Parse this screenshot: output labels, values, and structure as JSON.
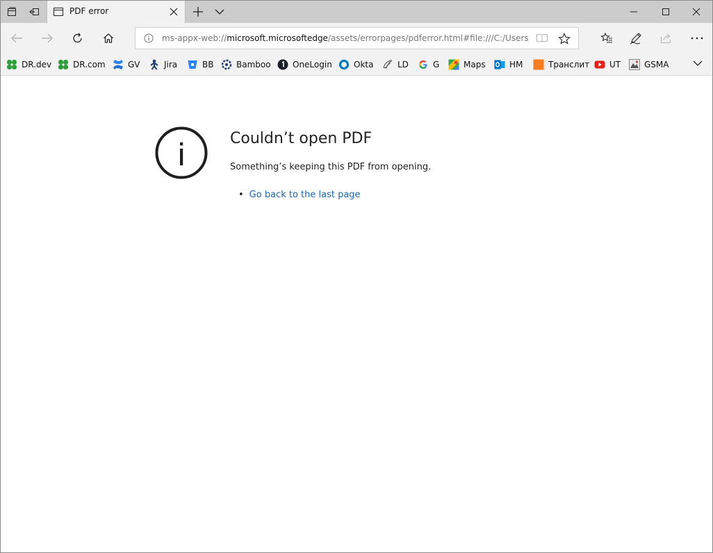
{
  "tab": {
    "title": "PDF error"
  },
  "address_bar": {
    "prefix": "ms-appx-web://",
    "host": "microsoft.microsoftedge",
    "path": "/assets/errorpages/pdferror.html#file:///C:/Users/Ar"
  },
  "favorites": [
    {
      "label": "DR.dev",
      "icon": "clover-icon",
      "color": "#2e9e3a"
    },
    {
      "label": "DR.com",
      "icon": "clover-icon",
      "color": "#2e9e3a"
    },
    {
      "label": "GV",
      "icon": "confluence-icon",
      "color": "#1f6fd6"
    },
    {
      "label": "Jira",
      "icon": "jira-icon",
      "color": "#1e3c72"
    },
    {
      "label": "BB",
      "icon": "bitbucket-icon",
      "color": "#2684ff"
    },
    {
      "label": "Bamboo",
      "icon": "bamboo-icon",
      "color": "#1e3c72"
    },
    {
      "label": "OneLogin",
      "icon": "onelogin-icon",
      "color": "#1c1f2a"
    },
    {
      "label": "Okta",
      "icon": "okta-icon",
      "color": "#007dc1"
    },
    {
      "label": "LD",
      "icon": "ld-icon",
      "color": "#666666"
    },
    {
      "label": "G",
      "icon": "google-icon",
      "color": "#4285f4"
    },
    {
      "label": "Maps",
      "icon": "maps-icon",
      "color": "#34a853"
    },
    {
      "label": "HM",
      "icon": "outlook-icon",
      "color": "#0072c6"
    },
    {
      "label": "Транслит",
      "icon": "translit-icon",
      "color": "#f57c1f"
    },
    {
      "label": "UT",
      "icon": "youtube-icon",
      "color": "#e62117"
    },
    {
      "label": "GSMA",
      "icon": "gsma-icon",
      "color": "#555555"
    }
  ],
  "content": {
    "title": "Couldn’t open PDF",
    "description": "Something’s keeping this PDF from opening.",
    "links": [
      "Go back to the last page"
    ]
  },
  "colors": {
    "link": "#1a66b3",
    "titlebar": "#cccccc",
    "toolbar": "#f2f2f2"
  }
}
